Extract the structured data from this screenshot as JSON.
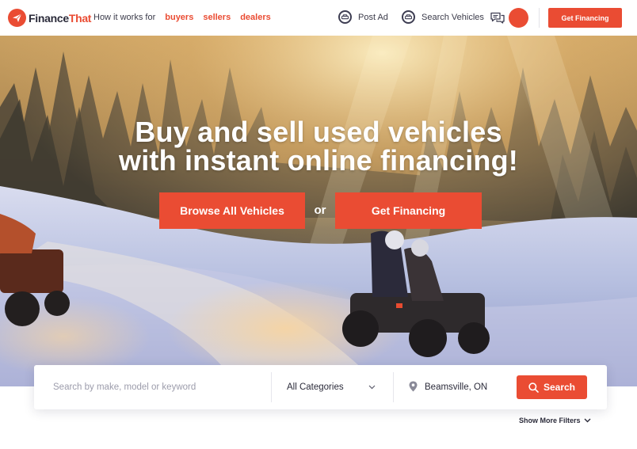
{
  "header": {
    "logo": {
      "text_dark": "Finance",
      "text_accent": "That"
    },
    "nav": {
      "how_it_works": "How it works for",
      "roles": [
        "buyers",
        "sellers",
        "dealers"
      ]
    },
    "post_ad": {
      "label": "Post Ad",
      "icon": "car-icon"
    },
    "search_vehicles": {
      "label": "Search Vehicles",
      "icon": "car-icon"
    },
    "messages_icon": "chat-bubbles-icon",
    "get_financing_label": "Get Financing"
  },
  "hero": {
    "title_line1": "Buy and sell used vehicles",
    "title_line2": "with instant online financing!",
    "browse_label": "Browse All Vehicles",
    "or_label": "or",
    "financing_label": "Get Financing",
    "background": "snowy forest trail with ATV riders at sunset"
  },
  "search": {
    "placeholder": "Search by make, model or keyword",
    "value": "",
    "category": "All Categories",
    "location": "Beamsville, ON",
    "button_label": "Search"
  },
  "filters": {
    "show_more_label": "Show More Filters"
  },
  "colors": {
    "accent": "#ea4c33",
    "text": "#2b2b3a",
    "icon_stroke": "#3d3d52"
  }
}
